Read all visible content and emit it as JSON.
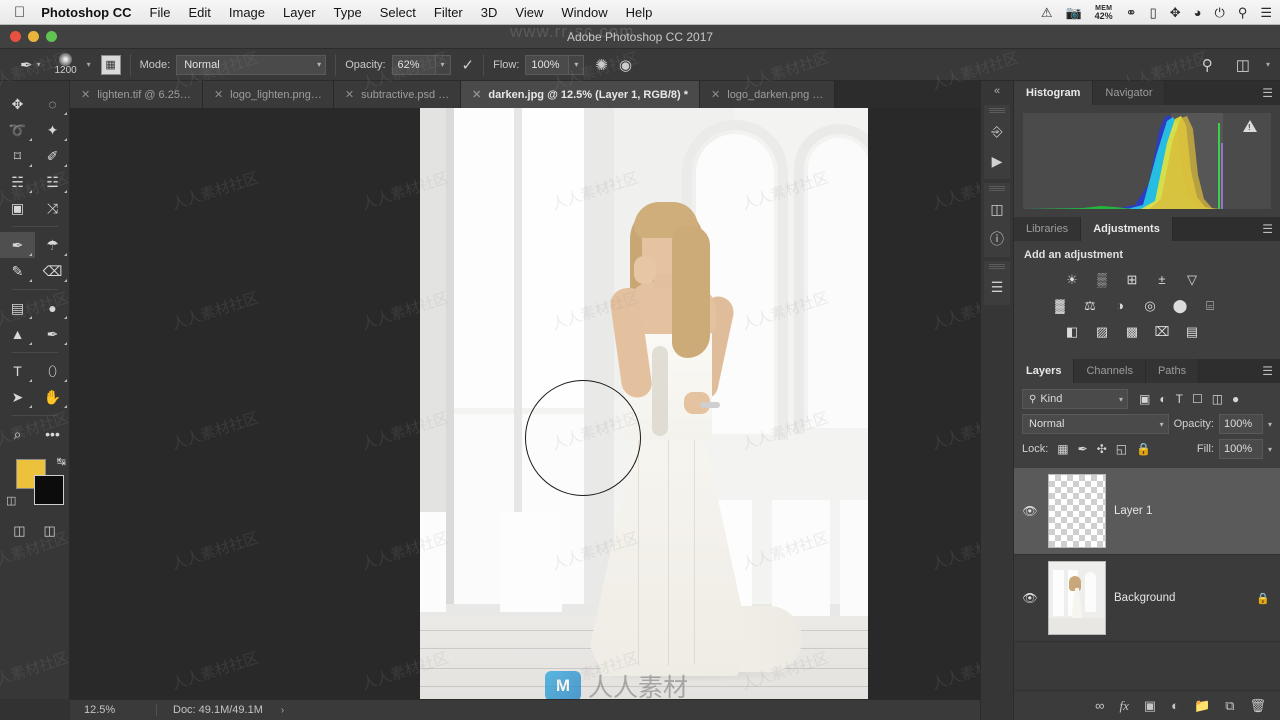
{
  "macbar": {
    "apple_icon": "apple-logo",
    "app_name": "Photoshop CC",
    "menus": [
      "File",
      "Edit",
      "Image",
      "Layer",
      "Type",
      "Select",
      "Filter",
      "3D",
      "View",
      "Window",
      "Help"
    ],
    "status_icons": [
      "warning-icon",
      "camera-icon",
      "creative-cloud-icon",
      "airplay-icon",
      "bluetooth-icon",
      "wifi-icon",
      "battery-charging-icon",
      "spotlight-search-icon",
      "notification-center-icon"
    ],
    "mem_label": "MEM",
    "mem_value": "42%"
  },
  "titlebar": {
    "window_title": "Adobe Photoshop CC 2017"
  },
  "options_bar": {
    "brush_tool_icon": "brush-icon",
    "brush_size": "1200",
    "toggle_brush_panel_icon": "brush-panel-icon",
    "mode_label": "Mode:",
    "mode_value": "Normal",
    "opacity_label": "Opacity:",
    "opacity_value": "62%",
    "pressure_opacity_icon": "pressure-opacity-icon",
    "flow_label": "Flow:",
    "flow_value": "100%",
    "airbrush_icon": "airbrush-icon",
    "pressure_size_icon": "pressure-size-icon",
    "symmetry_icon": "symmetry-icon",
    "search_icon": "search-icon",
    "workspace_icon": "workspace-icon"
  },
  "tabs": [
    {
      "label": "lighten.tif @ 6.25…",
      "active": false
    },
    {
      "label": "logo_lighten.png…",
      "active": false
    },
    {
      "label": "subtractive.psd …",
      "active": false
    },
    {
      "label": "darken.jpg @ 12.5% (Layer 1, RGB/8) *",
      "active": true
    },
    {
      "label": "logo_darken.png …",
      "active": false
    }
  ],
  "toolbar": {
    "tools": [
      {
        "name": "move-tool",
        "glyph": "✥",
        "active": false,
        "corner": false
      },
      {
        "name": "elliptical-marquee-tool",
        "glyph": "◌",
        "active": false,
        "corner": true
      },
      {
        "name": "lasso-tool",
        "glyph": "➰",
        "active": false,
        "corner": true
      },
      {
        "name": "magic-wand-tool",
        "glyph": "✦",
        "active": false,
        "corner": true
      },
      {
        "name": "crop-tool",
        "glyph": "⌑",
        "active": false,
        "corner": true
      },
      {
        "name": "eyedropper-tool",
        "glyph": "✐",
        "active": false,
        "corner": true
      },
      {
        "name": "spot-healing-brush-tool",
        "glyph": "☵",
        "active": false,
        "corner": true
      },
      {
        "name": "patch-tool",
        "glyph": "☳",
        "active": false,
        "corner": true
      },
      {
        "name": "frame-tool",
        "glyph": "▣",
        "active": false,
        "corner": false
      },
      {
        "name": "shuffle-tool",
        "glyph": "⤨",
        "active": false,
        "corner": false
      },
      {
        "name": "brush-tool",
        "glyph": "✒",
        "active": true,
        "corner": true
      },
      {
        "name": "clone-stamp-tool",
        "glyph": "☂",
        "active": false,
        "corner": true
      },
      {
        "name": "history-brush-tool",
        "glyph": "✎",
        "active": false,
        "corner": true
      },
      {
        "name": "eraser-tool",
        "glyph": "⌫",
        "active": false,
        "corner": true
      },
      {
        "name": "gradient-tool",
        "glyph": "▤",
        "active": false,
        "corner": true
      },
      {
        "name": "blur-tool",
        "glyph": "●",
        "active": false,
        "corner": true
      },
      {
        "name": "dodge-tool",
        "glyph": "▲",
        "active": false,
        "corner": true
      },
      {
        "name": "pen-tool",
        "glyph": "✒",
        "active": false,
        "corner": true
      },
      {
        "name": "type-tool",
        "glyph": "T",
        "active": false,
        "corner": true
      },
      {
        "name": "path-selection-tool",
        "glyph": "⬯",
        "active": false,
        "corner": true
      },
      {
        "name": "direct-selection-tool",
        "glyph": "➤",
        "active": false,
        "corner": true
      },
      {
        "name": "hand-tool",
        "glyph": "✋",
        "active": false,
        "corner": true
      },
      {
        "name": "zoom-tool",
        "glyph": "⌕",
        "active": false,
        "corner": false
      },
      {
        "name": "edit-toolbar-icon",
        "glyph": "•••",
        "active": false,
        "corner": false
      }
    ],
    "foreground_color": "#ecc23c",
    "background_color": "#0c0c0c",
    "swap_colors_icon": "swap-colors-icon",
    "default_colors_icon": "default-colors-icon",
    "quick_mask_icon": "quick-mask-icon",
    "screen_mode_icon": "screen-mode-icon"
  },
  "canvas": {
    "brush_cursor": "brush-cursor-circle",
    "watermark_text": "人人素材",
    "watermark_logo": "M",
    "watermark_url": "www.rr-sc.com",
    "tiles": [
      "人人素材社区"
    ]
  },
  "statusbar": {
    "zoom": "12.5%",
    "doc": "Doc: 49.1M/49.1M",
    "expand_arrow": "›"
  },
  "icon_rail": {
    "collapse_icon": "collapse-panels-icon",
    "buttons": [
      "actions-icon",
      "play-icon",
      "3d-icon",
      "info-icon",
      "measurement-log-icon"
    ]
  },
  "panels": {
    "histogram": {
      "tabs": [
        {
          "label": "Histogram",
          "active": true
        },
        {
          "label": "Navigator",
          "active": false
        }
      ],
      "menu_icon": "panel-menu-icon",
      "warning_icon": "cached-data-warning-icon"
    },
    "adjustments": {
      "tabs": [
        {
          "label": "Libraries",
          "active": false
        },
        {
          "label": "Adjustments",
          "active": true
        }
      ],
      "menu_icon": "panel-menu-icon",
      "title": "Add an adjustment",
      "rows": [
        [
          {
            "name": "brightness-contrast-icon",
            "glyph": "☀"
          },
          {
            "name": "levels-icon",
            "glyph": "▒"
          },
          {
            "name": "curves-icon",
            "glyph": "⊞"
          },
          {
            "name": "exposure-icon",
            "glyph": "±"
          },
          {
            "name": "vibrance-icon",
            "glyph": "▽"
          }
        ],
        [
          {
            "name": "hue-saturation-icon",
            "glyph": "▓"
          },
          {
            "name": "color-balance-icon",
            "glyph": "⚖"
          },
          {
            "name": "black-white-icon",
            "glyph": "◑"
          },
          {
            "name": "photo-filter-icon",
            "glyph": "◎"
          },
          {
            "name": "channel-mixer-icon",
            "glyph": "⬤"
          },
          {
            "name": "color-lookup-icon",
            "glyph": "⌸"
          }
        ],
        [
          {
            "name": "invert-icon",
            "glyph": "◧"
          },
          {
            "name": "posterize-icon",
            "glyph": "▨"
          },
          {
            "name": "threshold-icon",
            "glyph": "▩"
          },
          {
            "name": "gradient-map-icon",
            "glyph": "⌧"
          },
          {
            "name": "selective-color-icon",
            "glyph": "▤"
          }
        ]
      ]
    },
    "layers": {
      "tabs": [
        {
          "label": "Layers",
          "active": true
        },
        {
          "label": "Channels",
          "active": false
        },
        {
          "label": "Paths",
          "active": false
        }
      ],
      "menu_icon": "panel-menu-icon",
      "kind_label": "Kind",
      "kind_search_icon": "search-icon",
      "filter_icons": [
        "filter-pixel-icon",
        "filter-adjustment-icon",
        "filter-type-icon",
        "filter-shape-icon",
        "filter-smart-object-icon",
        "filter-toggle-icon"
      ],
      "blend_mode": "Normal",
      "opacity_label": "Opacity:",
      "opacity_value": "100%",
      "lock_label": "Lock:",
      "lock_icons": [
        "lock-transparent-pixels-icon",
        "lock-image-pixels-icon",
        "lock-position-icon",
        "lock-artboard-icon",
        "lock-all-icon"
      ],
      "fill_label": "Fill:",
      "fill_value": "100%",
      "rows": [
        {
          "name": "Layer 1",
          "visible": true,
          "selected": true,
          "locked": false,
          "thumb": "transparent"
        },
        {
          "name": "Background",
          "visible": true,
          "selected": false,
          "locked": true,
          "thumb": "photo"
        }
      ],
      "footer_icons": [
        "link-layers-icon",
        "add-layer-style-icon",
        "add-layer-mask-icon",
        "new-adjustment-layer-icon",
        "new-group-icon",
        "new-layer-icon",
        "delete-layer-icon"
      ],
      "footer_glyphs": [
        "⚭",
        "fx",
        "▣",
        "◐",
        "▰",
        "⧉",
        "☒"
      ]
    }
  }
}
